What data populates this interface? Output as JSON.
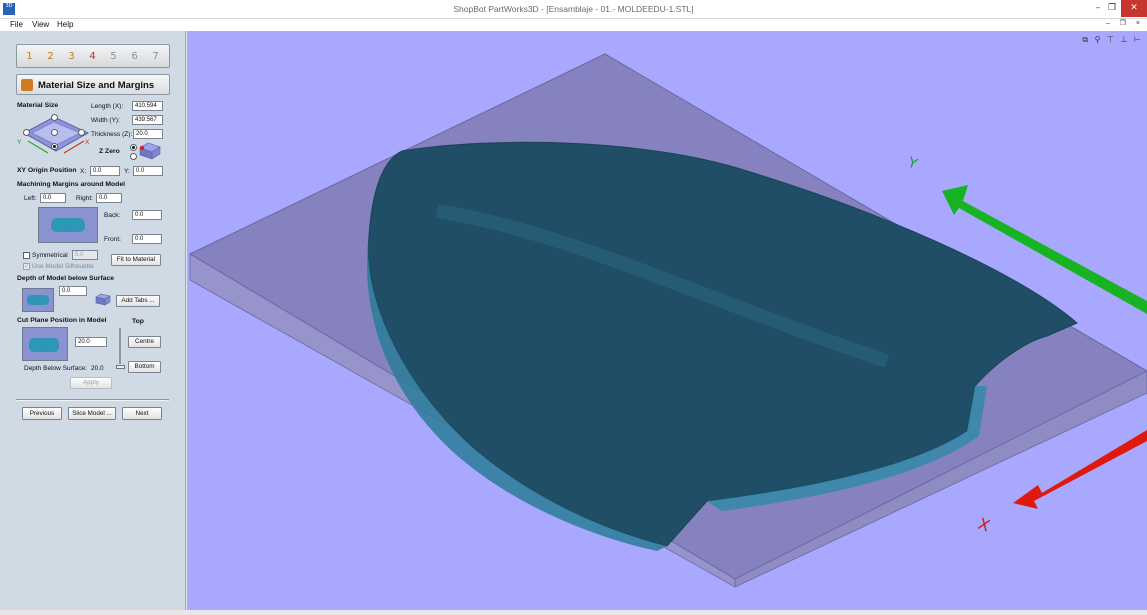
{
  "window": {
    "title": "ShopBot PartWorks3D - [Ensamblaje - 01.- MOLDEEDU-1.STL]",
    "app_icon_text": "3D",
    "minimize": "–",
    "restore": "❐",
    "close": "✕"
  },
  "menu": {
    "items": [
      {
        "label": "File"
      },
      {
        "label": "View"
      },
      {
        "label": "Help"
      }
    ],
    "mdi_controls": "– ❐ ×"
  },
  "panel": {
    "toolbar_icons": [
      "1",
      "2",
      "3",
      "4",
      "5",
      "6",
      "7"
    ],
    "section_title": "Material Size and Margins",
    "material_size": {
      "heading": "Material Size",
      "length_label": "Length (X):",
      "length_value": "410.594",
      "width_label": "Width (Y):",
      "width_value": "439.567",
      "thickness_label": "Thickness (Z):",
      "thickness_value": "20.0",
      "zzero_label": "Z Zero",
      "axis_y": "Y",
      "axis_x": "X"
    },
    "xy_origin": {
      "heading": "XY Origin Position",
      "x_label": "X:",
      "x_value": "0.0",
      "y_label": "Y:",
      "y_value": "0.0"
    },
    "margins": {
      "heading": "Machining Margins around Model",
      "left_label": "Left:",
      "left_value": "0.0",
      "right_label": "Right:",
      "right_value": "0.0",
      "back_label": "Back:",
      "back_value": "0.0",
      "front_label": "Front:",
      "front_value": "0.0",
      "symmetrical_label": "Symmetrical",
      "symmetrical_value": "5.0",
      "silhouette_label": "Use Model Silhouette",
      "fit_button": "Fit to Material"
    },
    "depth": {
      "heading": "Depth of Model below Surface",
      "value": "0.0",
      "add_tabs_button": "Add Tabs ..."
    },
    "cut_plane": {
      "heading": "Cut Plane Position in Model",
      "top_label": "Top",
      "value": "20.0",
      "centre_button": "Centre",
      "bottom_button": "Bottom",
      "depth_below_label": "Depth Below Surface:",
      "depth_below_value": "20.0",
      "apply_button": "Apply"
    },
    "nav": {
      "previous": "Previous",
      "slice": "Slice Model ...",
      "next": "Next"
    }
  },
  "viewport": {
    "background": "#a9a8ff",
    "view_icons": [
      "fit-view-icon",
      "iso-view-icon",
      "top-view-icon",
      "front-view-icon",
      "right-view-icon"
    ],
    "view_icon_glyphs": "⧉ ⚲ ⊤ ⊥ ⊢",
    "axis_y_label": "Y",
    "axis_x_label": "X",
    "colors": {
      "slab": "#8a86b8",
      "model": "#23546a",
      "y_arrow": "#18b322",
      "x_arrow": "#e0190f"
    }
  }
}
